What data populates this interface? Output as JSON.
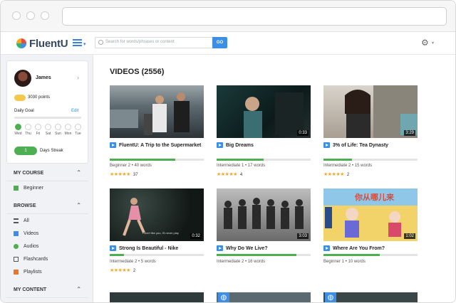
{
  "app": {
    "brand": "FluentU"
  },
  "search": {
    "placeholder": "Search for words/phrases or content",
    "go_label": "GO"
  },
  "user": {
    "name": "James",
    "points": "3030 points",
    "daily_goal_label": "Daily Goal",
    "edit_label": "Edit",
    "days": [
      {
        "label": "Wed",
        "done": true
      },
      {
        "label": "Thu",
        "done": true
      },
      {
        "label": "Fri",
        "done": false
      },
      {
        "label": "Sat",
        "done": false
      },
      {
        "label": "Sun",
        "done": false
      },
      {
        "label": "Mon",
        "done": false
      },
      {
        "label": "Tue",
        "done": false
      }
    ],
    "streak_count": "1",
    "streak_label": "Days Streak"
  },
  "sidebar": {
    "my_course": {
      "title": "MY COURSE",
      "items": [
        {
          "label": "Beginner",
          "icon": "grid-icon",
          "color": "#4cb050"
        }
      ]
    },
    "browse": {
      "title": "BROWSE",
      "items": [
        {
          "label": "All",
          "icon": "list-icon",
          "color": "#555555"
        },
        {
          "label": "Videos",
          "icon": "video-icon",
          "color": "#3d8ee6"
        },
        {
          "label": "Audios",
          "icon": "audio-icon",
          "color": "#4cb050"
        },
        {
          "label": "Flashcards",
          "icon": "flashcards-icon",
          "color": "#555555"
        },
        {
          "label": "Playlists",
          "icon": "playlists-icon",
          "color": "#e8762b"
        }
      ]
    },
    "my_content": {
      "title": "MY CONTENT"
    }
  },
  "main": {
    "heading": "VIDEOS (2556)",
    "videos": [
      {
        "title": "FluentU: A Trip to the Supermarket",
        "duration": "",
        "level": "Beginner 2",
        "words": "40 words",
        "rating": "37",
        "stars": "★★★★★",
        "progress": 0.7
      },
      {
        "title": "Big Dreams",
        "duration": "0:33",
        "level": "Intermediate 1",
        "words": "17 words",
        "rating": "4",
        "stars": "★★★★★",
        "progress": 0.5
      },
      {
        "title": "3% of Life: Tea Dynasty",
        "duration": "3:29",
        "level": "Intermediate 2",
        "words": "15 words",
        "rating": "2",
        "stars": "★★★★★",
        "progress": 0.3
      },
      {
        "title": "Strong Is Beautiful - Nike",
        "duration": "0:32",
        "level": "Intermediate 2",
        "words": "5 words",
        "rating": "2",
        "stars": "★★★★★",
        "progress": 0.15
      },
      {
        "title": "Why Do We Live?",
        "duration": "3:03",
        "level": "Intermediate 2",
        "words": "16 words",
        "rating": "",
        "stars": "",
        "progress": 0.85
      },
      {
        "title": "Where Are You From?",
        "duration": "1:02",
        "level": "Beginner 1",
        "words": "10 words",
        "rating": "",
        "stars": "",
        "progress": 0.6
      }
    ]
  }
}
